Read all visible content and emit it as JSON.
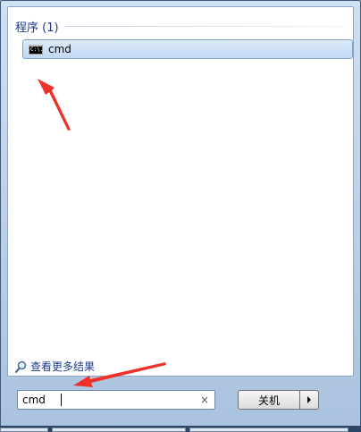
{
  "results": {
    "group_title": "程序 (1)",
    "items": [
      {
        "label": "cmd",
        "icon": "cmd-icon",
        "icon_text": "C:\\."
      }
    ]
  },
  "more_results": {
    "label": "查看更多结果",
    "icon": "magnifier-icon"
  },
  "search": {
    "value": "cmd",
    "clear_icon": "×"
  },
  "shutdown": {
    "label": "关机",
    "options_icon": "arrow-right-icon"
  },
  "annotations": {
    "arrow_color": "#f0302a"
  }
}
